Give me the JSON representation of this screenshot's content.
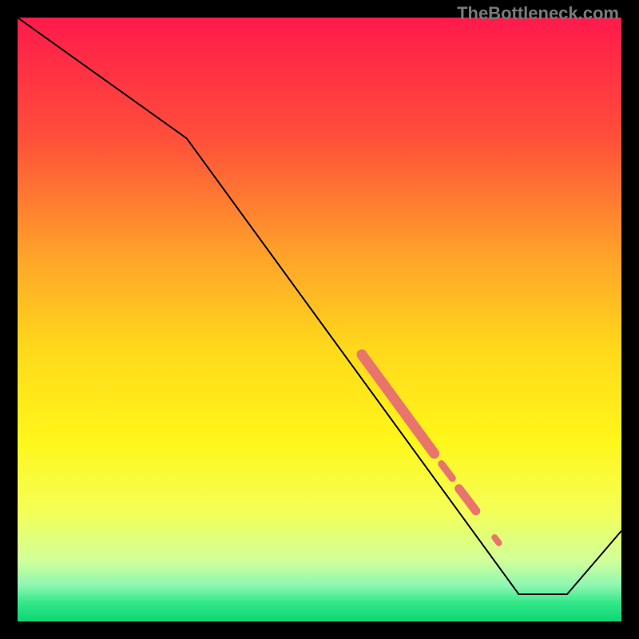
{
  "watermark": "TheBottleneck.com",
  "chart_data": {
    "type": "line",
    "title": "",
    "xlabel": "",
    "ylabel": "",
    "xlim": [
      0,
      100
    ],
    "ylim": [
      0,
      100
    ],
    "grid": false,
    "background_gradient": {
      "stops": [
        {
          "pos": 0.0,
          "color": "#ff1a4b"
        },
        {
          "pos": 0.2,
          "color": "#ff4f3a"
        },
        {
          "pos": 0.4,
          "color": "#ffa529"
        },
        {
          "pos": 0.55,
          "color": "#ffd91b"
        },
        {
          "pos": 0.7,
          "color": "#fff61a"
        },
        {
          "pos": 0.82,
          "color": "#f4ff58"
        },
        {
          "pos": 0.9,
          "color": "#d0ff9a"
        },
        {
          "pos": 0.94,
          "color": "#8ef7b2"
        },
        {
          "pos": 0.97,
          "color": "#31e788"
        },
        {
          "pos": 1.0,
          "color": "#0dd673"
        }
      ]
    },
    "series": [
      {
        "name": "bottleneck-curve",
        "color": "#000000",
        "width": 2,
        "x": [
          0,
          28,
          83,
          91,
          100
        ],
        "y": [
          100,
          80,
          4.5,
          4.5,
          15
        ]
      }
    ],
    "highlight_band": {
      "name": "highlight-points",
      "color": "#e9746c",
      "segments": [
        {
          "x0": 57,
          "y0": 44.2,
          "x1": 69,
          "y1": 27.8,
          "w": 13
        },
        {
          "x0": 70.2,
          "y0": 26.1,
          "x1": 72.0,
          "y1": 23.7,
          "w": 9
        },
        {
          "x0": 73.1,
          "y0": 22.0,
          "x1": 75.9,
          "y1": 18.3,
          "w": 11
        },
        {
          "x0": 79.0,
          "y0": 13.9,
          "x1": 79.7,
          "y1": 13.0,
          "w": 8
        }
      ]
    }
  }
}
